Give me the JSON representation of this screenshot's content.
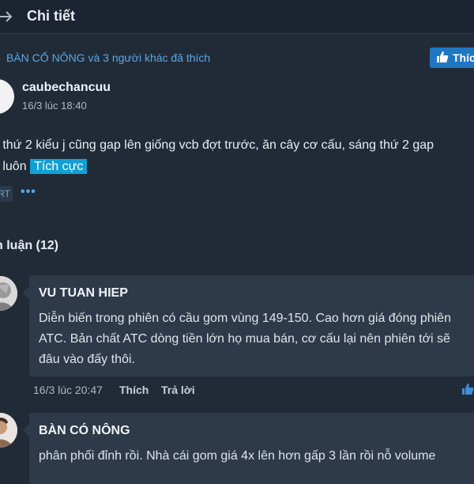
{
  "header": {
    "title": "Chi tiết"
  },
  "likes": {
    "first_user": "BÀN CỐ NÔNG",
    "rest": " và 3 người khác đã thích",
    "button_label": "Thíc"
  },
  "post": {
    "author": "caubechancuu",
    "time": "16/3 lúc 18:40",
    "line1": "g thứ 2 kiểu j cũng gap lên giống vcb đợt trước, ăn cây cơ cấu, sáng thứ 2 gap",
    "line2": "h luôn",
    "tag": "Tích cực",
    "rt_label": "RT",
    "more": "•••"
  },
  "comments_heading": "h luận (12)",
  "comments": [
    {
      "author": "VU TUAN HIEP",
      "text": "Diễn biến trong phiên có cầu gom vùng 149-150. Cao hơn giá đóng phiên ATC. Bản chất ATC dòng tiền lớn họ mua bán, cơ cấu lại nên phiên tới sẽ đâu vào đấy thôi.",
      "time": "16/3 lúc 20:47",
      "like_label": "Thích",
      "reply_label": "Trả lời"
    },
    {
      "author": "BÀN CÓ NÔNG",
      "text": "phân phối đỉnh rồi. Nhà cái gom giá 4x lên hơn gấp 3 lần rồi nỗ volume"
    }
  ],
  "colors": {
    "background": "#212b38",
    "comment_bg": "#2e3a4a",
    "accent": "#1f77c2",
    "link": "#5aa7e6",
    "tag": "#10a0d6"
  },
  "icons": {
    "back": "arrow-right-icon",
    "like": "thumbs-up-icon",
    "more": "ellipsis-icon"
  }
}
